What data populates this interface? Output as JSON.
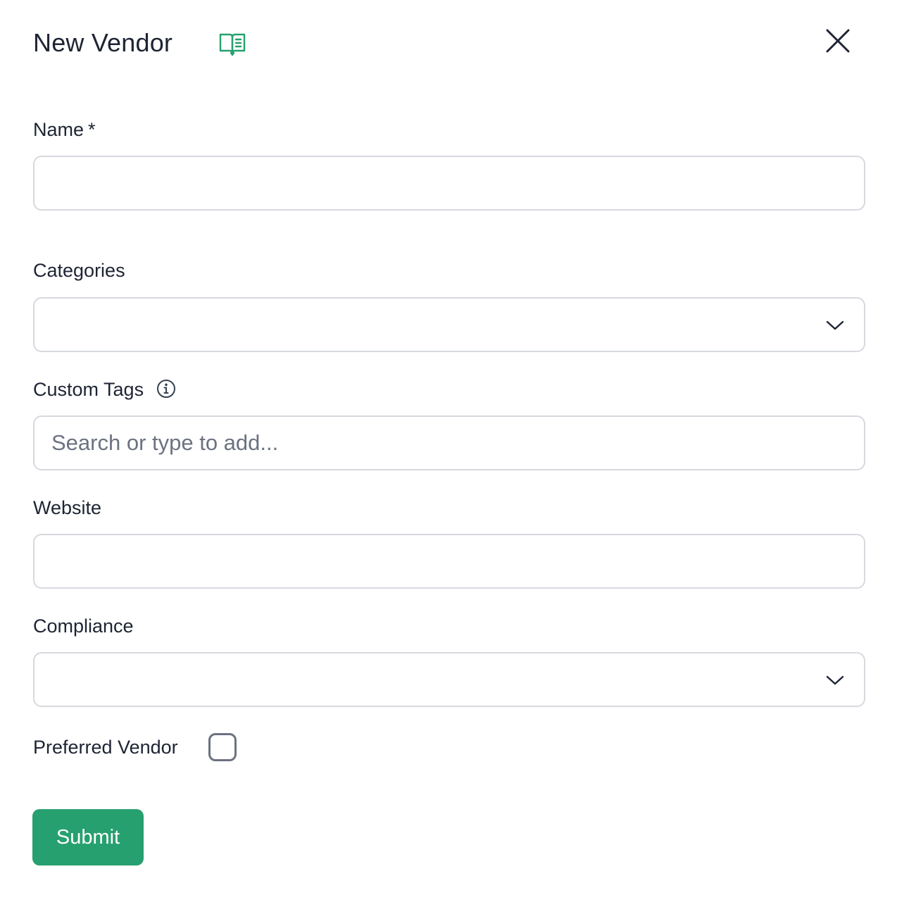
{
  "header": {
    "title": "New Vendor",
    "docs_icon": "book-open-icon",
    "close_icon": "close-icon",
    "accent_color": "#27a06f"
  },
  "form": {
    "name": {
      "label": "Name",
      "required_marker": "*",
      "value": "",
      "placeholder": ""
    },
    "categories": {
      "label": "Categories",
      "selected": "",
      "icon": "chevron-down-icon"
    },
    "custom_tags": {
      "label": "Custom Tags",
      "info_icon": "info-icon",
      "value": "",
      "placeholder": "Search or type to add..."
    },
    "website": {
      "label": "Website",
      "value": "",
      "placeholder": ""
    },
    "compliance": {
      "label": "Compliance",
      "selected": "",
      "icon": "chevron-down-icon"
    },
    "preferred_vendor": {
      "label": "Preferred Vendor",
      "checked": false
    },
    "submit_label": "Submit"
  }
}
